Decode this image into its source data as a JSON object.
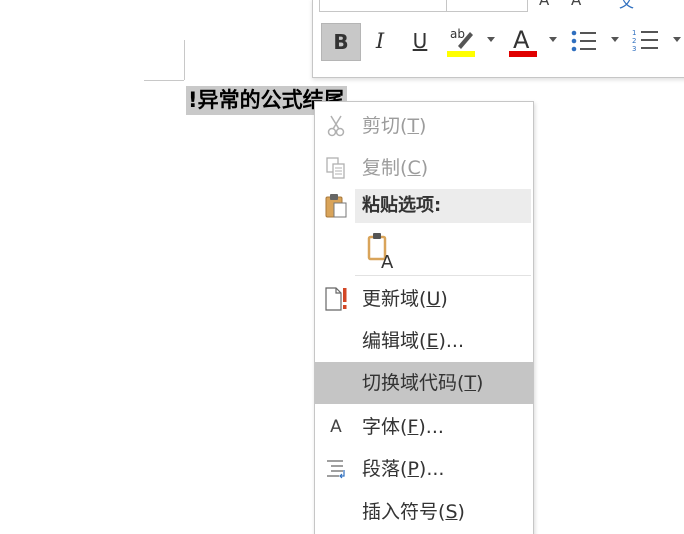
{
  "document": {
    "field_text": "!异常的公式结尾"
  },
  "mini_toolbar": {
    "bold_label": "B",
    "italic_label": "I",
    "underline_label": "U",
    "highlight_color": "#ffff00",
    "font_color": "#e00000",
    "font_color_glyph": "A",
    "highlight_glyph": "ab"
  },
  "context_menu": {
    "cut": {
      "label": "剪切",
      "key": "T",
      "enabled": false
    },
    "copy": {
      "label": "复制",
      "key": "C",
      "enabled": false
    },
    "paste_options": {
      "label": "粘贴选项:"
    },
    "paste_keep_text_glyph": "A",
    "update_field": {
      "label": "更新域",
      "key": "U"
    },
    "edit_field": {
      "label": "编辑域",
      "key": "E",
      "suffix": "..."
    },
    "toggle_field_codes": {
      "label": "切换域代码",
      "key": "T",
      "highlighted": true
    },
    "font": {
      "label": "字体",
      "key": "F",
      "suffix": "...",
      "icon_glyph": "A"
    },
    "paragraph": {
      "label": "段落",
      "key": "P",
      "suffix": "..."
    },
    "insert_symbol": {
      "label": "插入符号",
      "key": "S"
    }
  },
  "colors": {
    "menu_highlight": "#c5c5c5",
    "disabled_text": "#9c9c9c",
    "selection": "#c9c9c9"
  }
}
